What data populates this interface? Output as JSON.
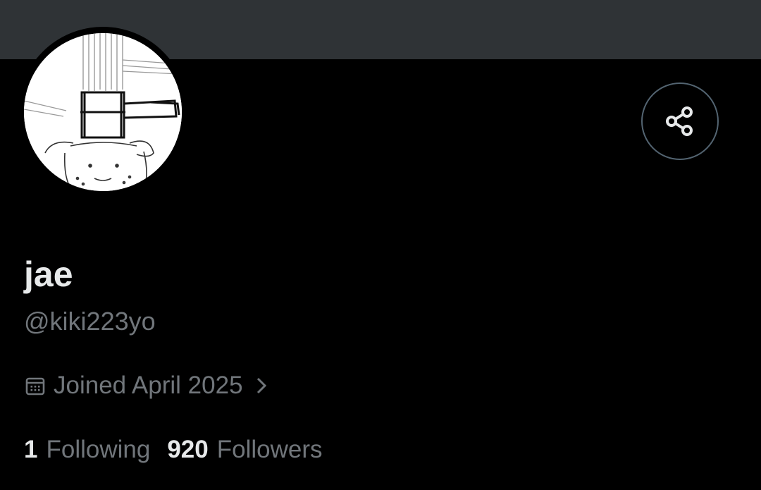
{
  "profile": {
    "display_name": "jae",
    "handle": "@kiki223yo",
    "joined": "Joined April 2025",
    "following_count": "1",
    "following_label": "Following",
    "followers_count": "920",
    "followers_label": "Followers"
  },
  "icons": {
    "share": "share-icon",
    "calendar": "calendar-icon",
    "chevron": "chevron-right-icon"
  },
  "colors": {
    "background": "#000000",
    "banner": "#2f3336",
    "primary_text": "#e7e9ea",
    "secondary_text": "#71767b",
    "button_border": "#536471"
  }
}
